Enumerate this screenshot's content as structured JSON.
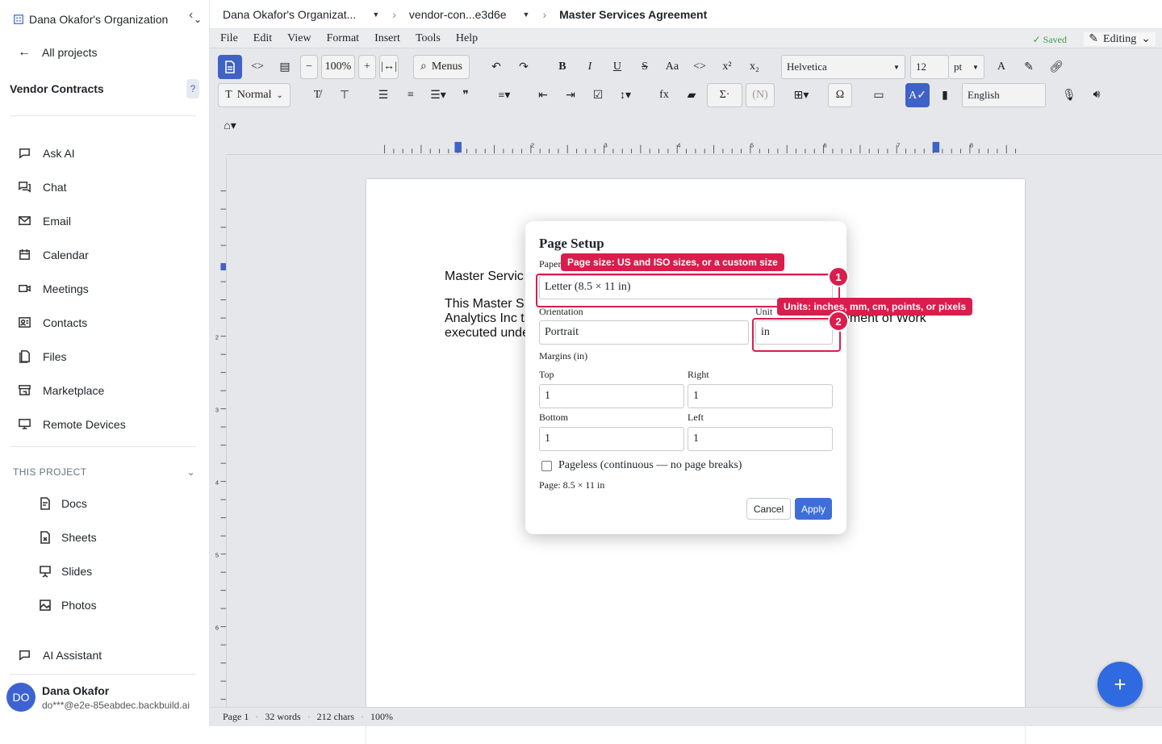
{
  "sidebar": {
    "org_name": "Dana Okafor's Organization",
    "all_projects": "All projects",
    "project_name": "Vendor Contracts",
    "help_glyph": "?",
    "nav": [
      {
        "label": "Ask AI",
        "icon": "chat-bubble-icon"
      },
      {
        "label": "Chat",
        "icon": "chat-icon"
      },
      {
        "label": "Email",
        "icon": "mail-icon"
      },
      {
        "label": "Calendar",
        "icon": "calendar-icon"
      },
      {
        "label": "Meetings",
        "icon": "video-icon"
      },
      {
        "label": "Contacts",
        "icon": "contacts-icon"
      },
      {
        "label": "Files",
        "icon": "files-icon"
      },
      {
        "label": "Marketplace",
        "icon": "store-icon"
      },
      {
        "label": "Remote Devices",
        "icon": "monitor-icon"
      }
    ],
    "section_label": "THIS PROJECT",
    "project_items": [
      {
        "label": "Docs",
        "icon": "docs-icon"
      },
      {
        "label": "Sheets",
        "icon": "sheets-icon"
      },
      {
        "label": "Slides",
        "icon": "slides-icon"
      },
      {
        "label": "Photos",
        "icon": "photos-icon"
      }
    ],
    "ai_assistant": "AI Assistant",
    "user": {
      "initials": "DO",
      "name": "Dana Okafor",
      "email": "do***@e2e-85eabdec.backbuild.ai"
    }
  },
  "breadcrumb": {
    "org": "Dana Okafor's Organizat...",
    "folder": "vendor-con...e3d6e",
    "document": "Master Services Agreement"
  },
  "menubar": [
    "File",
    "Edit",
    "View",
    "Format",
    "Insert",
    "Tools",
    "Help"
  ],
  "status_saved": "✓ Saved",
  "mode": "Editing",
  "toolbar": {
    "zoom": "100%",
    "menus": "Menus",
    "font": "Helvetica",
    "font_size": "12",
    "font_unit": "pt",
    "style": "Normal",
    "language": "English"
  },
  "ruler_numbers": [
    "2",
    "3",
    "4",
    "5",
    "6",
    "7",
    "8"
  ],
  "vruler_numbers": [
    "2",
    "3",
    "4",
    "5",
    "6"
  ],
  "page_text": {
    "heading": "Master Servic",
    "line1": "This Master S",
    "line2": "Analytics Inc t",
    "line3": "executed unde",
    "line1_tail": "ement of Work"
  },
  "dialog": {
    "title": "Page Setup",
    "paper_label": "Paper",
    "paper_value": "Letter (8.5 × 11 in)",
    "orientation_label": "Orientation",
    "orientation_value": "Portrait",
    "unit_label": "Unit",
    "unit_value": "in",
    "margins_label": "Margins (in)",
    "top_label": "Top",
    "top_value": "1",
    "right_label": "Right",
    "right_value": "1",
    "bottom_label": "Bottom",
    "bottom_value": "1",
    "left_label": "Left",
    "left_value": "1",
    "pageless_label": "Pageless (continuous — no page breaks)",
    "pageless_checked": false,
    "page_info": "Page: 8.5 × 11 in",
    "cancel": "Cancel",
    "apply": "Apply"
  },
  "annotations": [
    {
      "number": "1",
      "text": "Page size: US and ISO sizes, or a custom size"
    },
    {
      "number": "2",
      "text": "Units: inches, mm, cm, points, or pixels"
    }
  ],
  "statusbar": {
    "page": "Page 1",
    "words": "32 words",
    "chars": "212 chars",
    "zoom": "100%"
  },
  "fab_label": "+"
}
